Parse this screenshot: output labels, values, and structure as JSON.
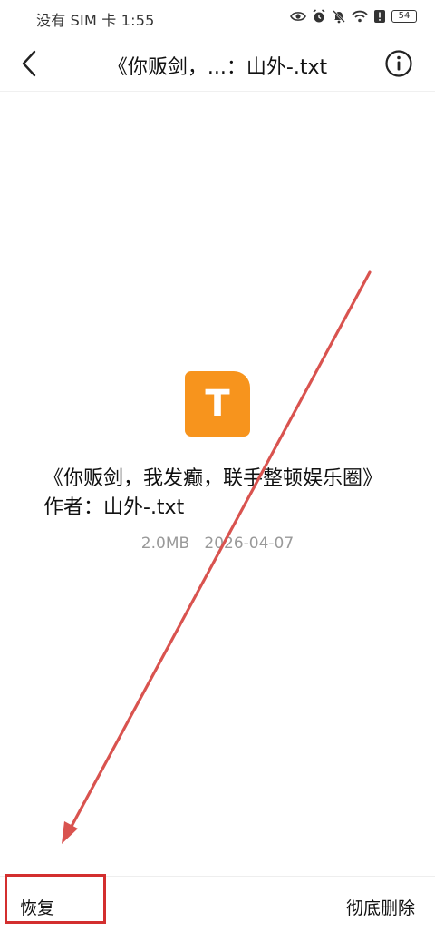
{
  "status_bar": {
    "text": "没有 SIM 卡 1:55",
    "battery": "54"
  },
  "header": {
    "title": "《你贩剑，...：山外-.txt"
  },
  "file": {
    "icon_letter": "T",
    "icon_color": "#f7941d",
    "name": "《你贩剑，我发癫，联手整顿娱乐圈》作者：山外-.txt",
    "size": "2.0MB",
    "date": "2026-04-07"
  },
  "bottom_bar": {
    "restore_label": "恢复",
    "delete_label": "彻底删除"
  },
  "annotation": {
    "color": "#d32f2f"
  }
}
